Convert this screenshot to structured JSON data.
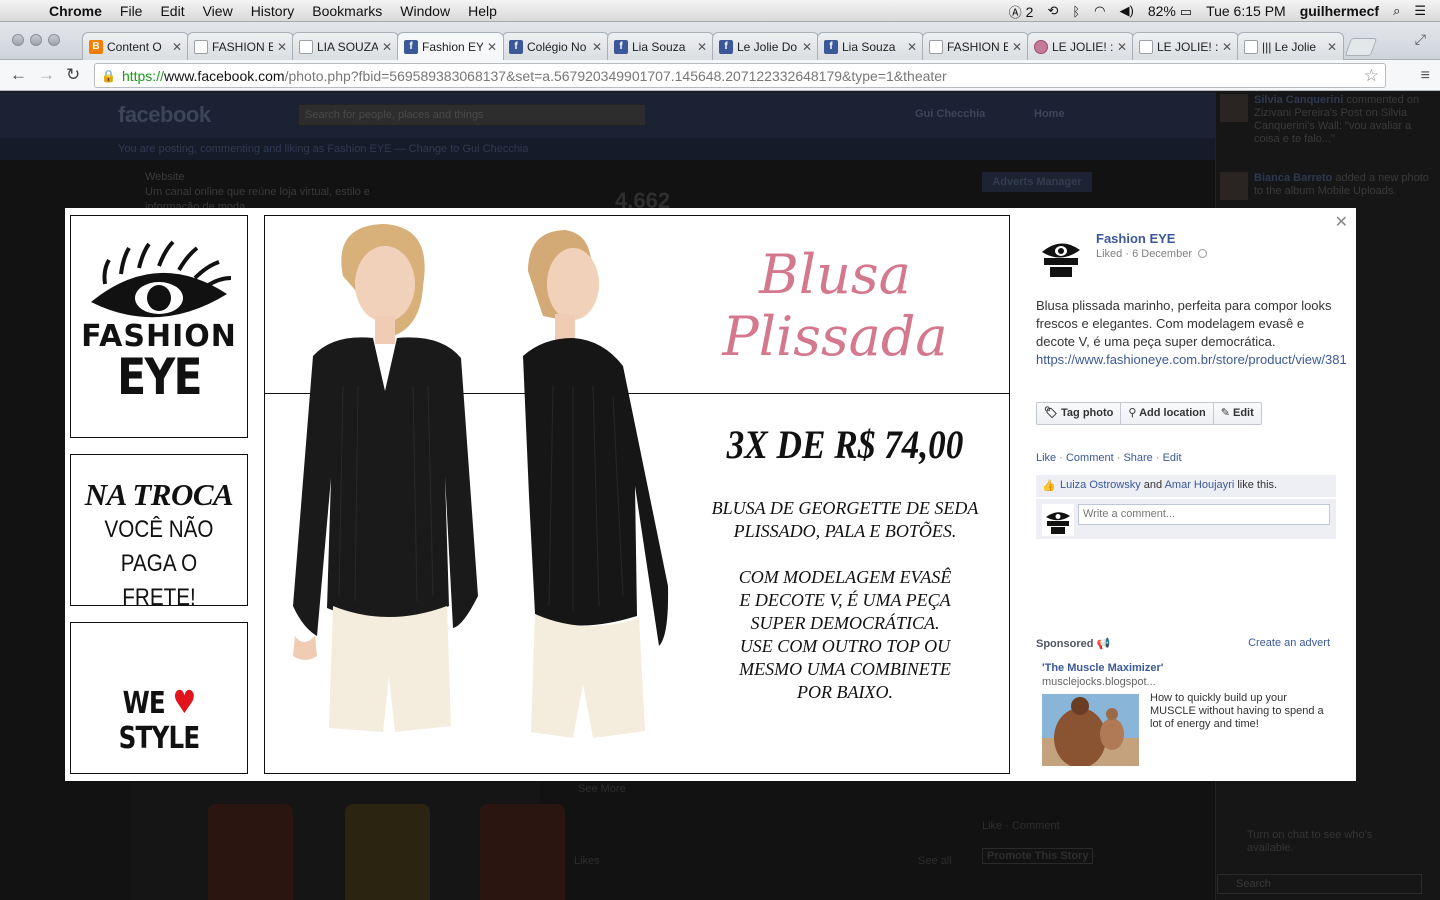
{
  "menubar": {
    "app": "Chrome",
    "items": [
      "File",
      "Edit",
      "View",
      "History",
      "Bookmarks",
      "Window",
      "Help"
    ],
    "adobe_count": "2",
    "battery": "82%",
    "clock": "Tue 6:15 PM",
    "user": "guilhermecf"
  },
  "tabs": [
    {
      "title": "Content O",
      "icon": "blogger-icon"
    },
    {
      "title": "FASHION E",
      "icon": "page-icon"
    },
    {
      "title": "LIA SOUZA",
      "icon": "page-icon"
    },
    {
      "title": "Fashion EY",
      "icon": "facebook-icon"
    },
    {
      "title": "Colégio No",
      "icon": "facebook-icon"
    },
    {
      "title": "Lia Souza",
      "icon": "facebook-icon"
    },
    {
      "title": "Le Jolie Do",
      "icon": "facebook-icon"
    },
    {
      "title": "Lia Souza",
      "icon": "facebook-icon"
    },
    {
      "title": "FASHION E",
      "icon": "page-icon"
    },
    {
      "title": "LE JOLIE! :",
      "icon": "lejolie-icon"
    },
    {
      "title": "LE JOLIE! :C",
      "icon": "page-icon"
    },
    {
      "title": "||| Le Jolie",
      "icon": "page-icon"
    }
  ],
  "address": {
    "scheme": "https://",
    "host": "www.facebook.com",
    "rest": "/photo.php?fbid=569589383068137&set=a.567920349901707.145648.207122332648179&type=1&theater"
  },
  "fb_background": {
    "logo": "facebook",
    "search_placeholder": "Search for people, places and things",
    "user": "Gui Checchia",
    "home": "Home",
    "notice": "You are posting, commenting and liking as Fashion EYE — Change to Gui Checchia",
    "website_label": "Website",
    "website_text": "Um canal online que reúne loja virtual, estilo e informação de moda",
    "likes_count": "4.662",
    "adverts_manager": "Adverts Manager",
    "see_more": "See More",
    "likes": "Likes",
    "see_all": "See all",
    "like_comment": "Like · Comment",
    "promote": "Promote This Story",
    "chat_hint": "Turn on chat to see who's available.",
    "chat_search": "Search",
    "ticker": [
      {
        "name": "Silvia Canquerini",
        "text": "commented on Zizivani Pereira's Post on Silvia Canquerini's Wall: \"vou avaliar a coisa e te falo...\""
      },
      {
        "name": "Bianca Barreto",
        "text": "added a new photo to the album Mobile Uploads."
      }
    ]
  },
  "photo": {
    "logo_word1": "FASHION",
    "logo_word2": "EYE",
    "na_troca": "NA TROCA",
    "na_troca_line1": "VOCÊ NÃO",
    "na_troca_line2": "PAGA O FRETE!",
    "we": "WE",
    "style": "STYLE",
    "title_line1": "Blusa",
    "title_line2": "Plissada",
    "price": "3X DE R$ 74,00",
    "desc1_line1": "BLUSA DE GEORGETTE DE SEDA",
    "desc1_line2": "PLISSADO, PALA E BOTÕES.",
    "desc2_line1": "COM MODELAGEM EVASÊ",
    "desc2_line2": "E DECOTE V, É UMA PEÇA",
    "desc2_line3": "SUPER DEMOCRÁTICA.",
    "desc2_line4": "USE COM OUTRO TOP OU",
    "desc2_line5": "MESMO UMA COMBINETE",
    "desc2_line6": "POR BAIXO."
  },
  "info": {
    "page_name": "Fashion EYE",
    "liked_date": "Liked · 6 December",
    "caption": "Blusa plissada marinho, perfeita para compor looks frescos e elegantes. Com modelagem evasê e decote V, é uma peça super democrática. ",
    "caption_link": "https://www.fashioneye.com.br/store/product/view/381",
    "tag_photo": "Tag photo",
    "add_location": "Add location",
    "edit": "Edit",
    "act_like": "Like",
    "act_comment": "Comment",
    "act_share": "Share",
    "act_edit": "Edit",
    "liker1": "Luiza Ostrowsky",
    "and": "and",
    "liker2": "Amar Houjayri",
    "like_this": "like this.",
    "comment_placeholder": "Write a comment...",
    "sponsored": "Sponsored",
    "create_advert": "Create an advert",
    "ad_title": "'The Muscle Maximizer'",
    "ad_url": "musclejocks.blogspot...",
    "ad_text": "How to quickly build up your MUSCLE without having to spend a lot of energy and time!"
  }
}
